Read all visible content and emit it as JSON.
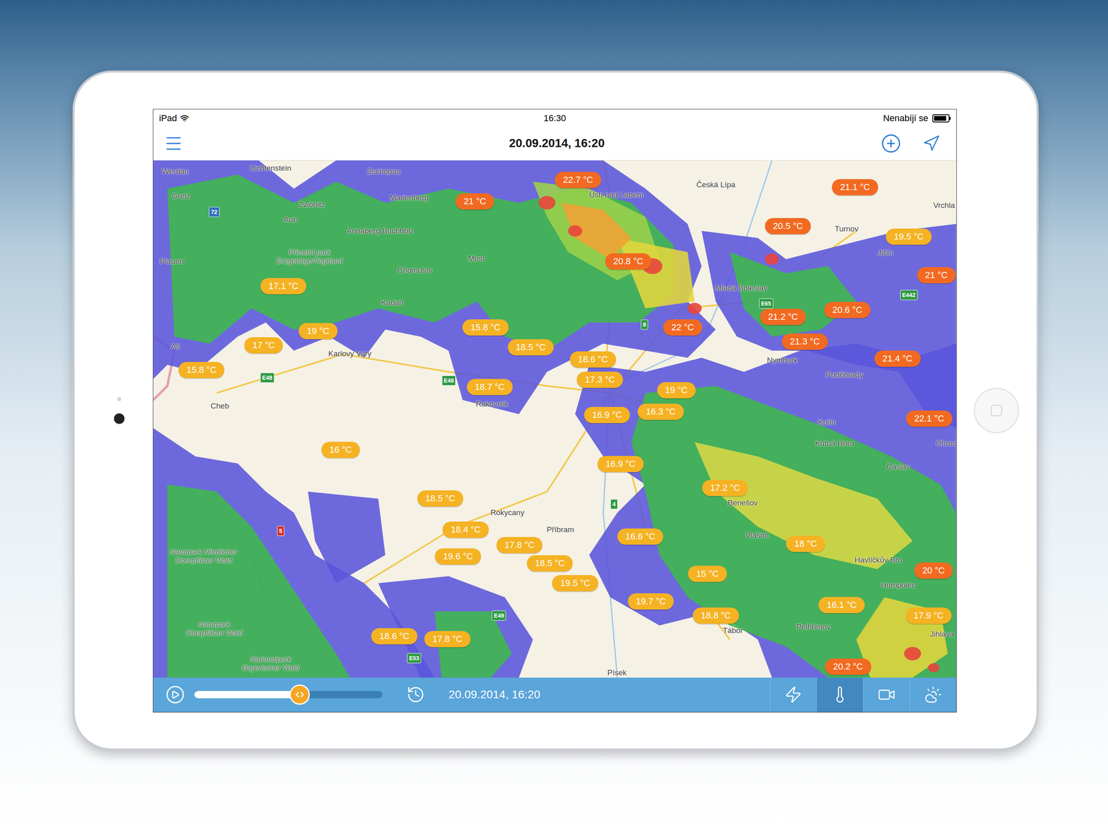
{
  "status_bar": {
    "device": "iPad",
    "time": "16:30",
    "battery": "Nenabíjí se",
    "battery_level": 0.9
  },
  "nav": {
    "title": "20.09.2014, 16:20"
  },
  "map": {
    "temperatures": [
      {
        "label": "22.7 °C",
        "color": "#f26a21"
      },
      {
        "label": "21 °C",
        "color": "#f26a21"
      },
      {
        "label": "21.1 °C",
        "color": "#f26a21"
      },
      {
        "label": "20.5 °C",
        "color": "#f26a21"
      },
      {
        "label": "19.5 °C",
        "color": "#f5b223"
      },
      {
        "label": "21 °C",
        "color": "#f26a21"
      },
      {
        "label": "20.8 °C",
        "color": "#f26a21"
      },
      {
        "label": "17.1 °C",
        "color": "#f5b223"
      },
      {
        "label": "20.6 °C",
        "color": "#f26a21"
      },
      {
        "label": "21.2 °C",
        "color": "#f26a21"
      },
      {
        "label": "22 °C",
        "color": "#f26a21"
      },
      {
        "label": "21.3 °C",
        "color": "#f26a21"
      },
      {
        "label": "21.4 °C",
        "color": "#f26a21"
      },
      {
        "label": "19 °C",
        "color": "#f5b223"
      },
      {
        "label": "17 °C",
        "color": "#f5b223"
      },
      {
        "label": "15.8 °C",
        "color": "#f5b223"
      },
      {
        "label": "15.8 °C",
        "color": "#f5b223"
      },
      {
        "label": "18.5 °C",
        "color": "#f5b223"
      },
      {
        "label": "18.6 °C",
        "color": "#f5b223"
      },
      {
        "label": "18.7 °C",
        "color": "#f5b223"
      },
      {
        "label": "17.3 °C",
        "color": "#f5b223"
      },
      {
        "label": "19 °C",
        "color": "#f5b223"
      },
      {
        "label": "16.9 °C",
        "color": "#f5b223"
      },
      {
        "label": "16.3 °C",
        "color": "#f5b223"
      },
      {
        "label": "22.1 °C",
        "color": "#f26a21"
      },
      {
        "label": "16 °C",
        "color": "#f5b223"
      },
      {
        "label": "16.9 °C",
        "color": "#f5b223"
      },
      {
        "label": "17.2 °C",
        "color": "#f5b223"
      },
      {
        "label": "18.5 °C",
        "color": "#f5b223"
      },
      {
        "label": "18.4 °C",
        "color": "#f5b223"
      },
      {
        "label": "17.8 °C",
        "color": "#f5b223"
      },
      {
        "label": "19.6 °C",
        "color": "#f5b223"
      },
      {
        "label": "18.5 °C",
        "color": "#f5b223"
      },
      {
        "label": "16.6 °C",
        "color": "#f5b223"
      },
      {
        "label": "18 °C",
        "color": "#f5b223"
      },
      {
        "label": "15 °C",
        "color": "#f5b223"
      },
      {
        "label": "19.5 °C",
        "color": "#f5b223"
      },
      {
        "label": "20 °C",
        "color": "#f26a21"
      },
      {
        "label": "19.7 °C",
        "color": "#f5b223"
      },
      {
        "label": "16.1 °C",
        "color": "#f5b223"
      },
      {
        "label": "18.8 °C",
        "color": "#f5b223"
      },
      {
        "label": "17.9 °C",
        "color": "#f5b223"
      },
      {
        "label": "18.6 °C",
        "color": "#f5b223"
      },
      {
        "label": "17.8 °C",
        "color": "#f5b223"
      },
      {
        "label": "20.2 °C",
        "color": "#f26a21"
      }
    ],
    "places": [
      {
        "label": "Werdau",
        "kind": "town"
      },
      {
        "label": "Lichtenstein",
        "kind": "town"
      },
      {
        "label": "Zschopau",
        "kind": "town"
      },
      {
        "label": "Greiz",
        "kind": "town"
      },
      {
        "label": "Zwönitz",
        "kind": "town"
      },
      {
        "label": "Aue",
        "kind": "town"
      },
      {
        "label": "Marienberg",
        "kind": "town"
      },
      {
        "label": "Annaberg Buchholz",
        "kind": "town"
      },
      {
        "label": "Ústí nad Labem",
        "kind": "town"
      },
      {
        "label": "Česká Lípa",
        "kind": "town"
      },
      {
        "label": "Turnov",
        "kind": "town"
      },
      {
        "label": "Vrchla",
        "kind": "town"
      },
      {
        "label": "Přírodní park Erzgebirge/Vogtland",
        "kind": "park"
      },
      {
        "label": "Plauen",
        "kind": "town"
      },
      {
        "label": "Chomutov",
        "kind": "town"
      },
      {
        "label": "Most",
        "kind": "town"
      },
      {
        "label": "Kadaň",
        "kind": "town"
      },
      {
        "label": "Mladá Boleslav",
        "kind": "town"
      },
      {
        "label": "Jičín",
        "kind": "town"
      },
      {
        "label": "Karlovy Vary",
        "kind": "town"
      },
      {
        "label": "Cheb",
        "kind": "town"
      },
      {
        "label": "Aš",
        "kind": "town"
      },
      {
        "label": "Rakovník",
        "kind": "town"
      },
      {
        "label": "Nymburk",
        "kind": "town"
      },
      {
        "label": "Poděbrady",
        "kind": "town"
      },
      {
        "label": "Kolín",
        "kind": "town"
      },
      {
        "label": "Kutná Hora",
        "kind": "town"
      },
      {
        "label": "Čáslav",
        "kind": "town"
      },
      {
        "label": "Chruc",
        "kind": "town"
      },
      {
        "label": "Rokycany",
        "kind": "town"
      },
      {
        "label": "Příbram",
        "kind": "town"
      },
      {
        "label": "Benešov",
        "kind": "town"
      },
      {
        "label": "Vlašim",
        "kind": "town"
      },
      {
        "label": "Havlíčkův Bro",
        "kind": "town"
      },
      {
        "label": "Humpolec",
        "kind": "town"
      },
      {
        "label": "Pelhřimov",
        "kind": "town"
      },
      {
        "label": "Jihlava",
        "kind": "town"
      },
      {
        "label": "Tábor",
        "kind": "town"
      },
      {
        "label": "Písek",
        "kind": "town"
      },
      {
        "label": "Naturpark Nördlicher Oberpfälzer Wald",
        "kind": "park"
      },
      {
        "label": "Naturpark Oberpfälzer Wald",
        "kind": "park"
      },
      {
        "label": "Nationalpark Bayerischer Wald",
        "kind": "park"
      }
    ],
    "road_signs": [
      {
        "label": "72",
        "color": "#2f6fc0"
      },
      {
        "label": "E48",
        "color": "#2e9a44"
      },
      {
        "label": "E48",
        "color": "#2e9a44"
      },
      {
        "label": "E65",
        "color": "#2e9a44"
      },
      {
        "label": "E442",
        "color": "#2e9a44"
      },
      {
        "label": "8",
        "color": "#2e9a44"
      },
      {
        "label": "5",
        "color": "#d0342c"
      },
      {
        "label": "4",
        "color": "#2e9a44"
      },
      {
        "label": "E49",
        "color": "#2e9a44"
      },
      {
        "label": "E53",
        "color": "#2e9a44"
      }
    ]
  },
  "toolbar": {
    "playing": false,
    "timeline": {
      "level": 0.56
    },
    "time": "20.09.2014, 16:20",
    "tabs": [
      {
        "kind": "lightning",
        "selected": false
      },
      {
        "kind": "temperature",
        "selected": true
      },
      {
        "kind": "camera",
        "selected": false
      },
      {
        "kind": "forecast",
        "selected": false
      }
    ]
  }
}
